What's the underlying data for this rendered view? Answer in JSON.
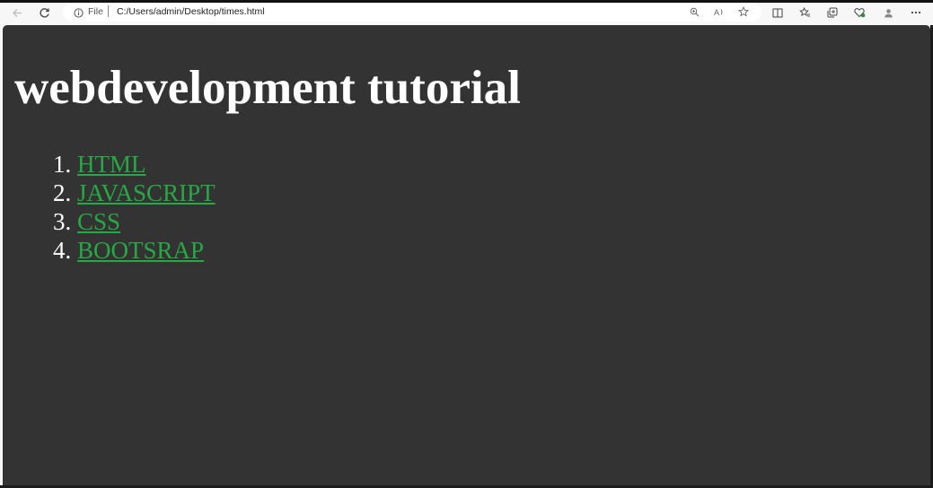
{
  "browser": {
    "scheme_label": "File",
    "url": "C:/Users/admin/Desktop/times.html",
    "icons": [
      "back-icon",
      "refresh-icon",
      "info-icon",
      "zoom-icon",
      "read-aloud-icon",
      "favorite-star-icon",
      "split-screen-icon",
      "favorites-icon",
      "collections-icon",
      "browser-essentials-icon",
      "profile-icon",
      "more-icon"
    ]
  },
  "page": {
    "heading": "webdevelopment tutorial",
    "list": [
      {
        "number": "1.",
        "label": "HTML"
      },
      {
        "number": "2.",
        "label": "JAVASCRIPT"
      },
      {
        "number": "3.",
        "label": "CSS"
      },
      {
        "number": "4.",
        "label": "BOOTSRAP"
      }
    ]
  },
  "colors": {
    "page_background": "#333333",
    "heading_color": "#ffffff",
    "link_color": "#28a745",
    "toolbar_background": "#f7f7f7"
  }
}
